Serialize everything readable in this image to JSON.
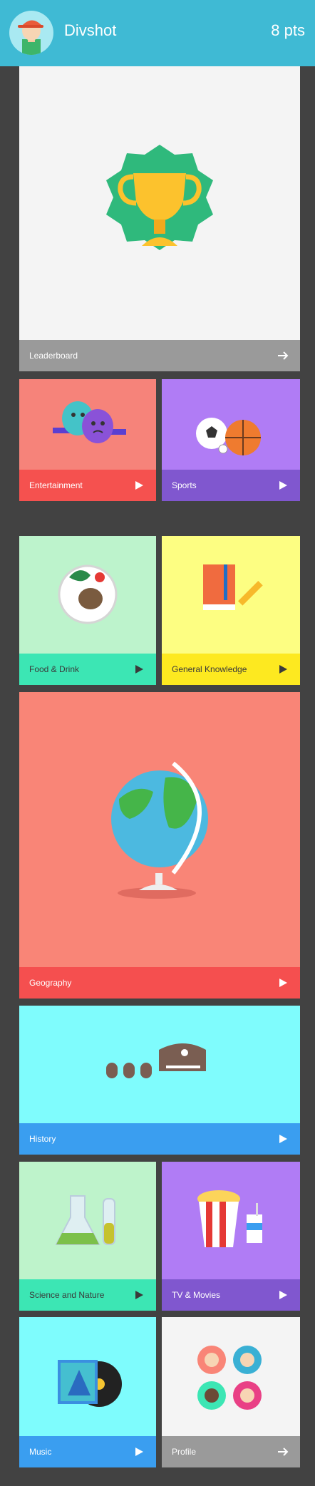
{
  "header": {
    "title": "Divshot",
    "points": "8 pts"
  },
  "cards": {
    "leaderboard": {
      "label": "Leaderboard"
    },
    "entertainment": {
      "label": "Entertainment"
    },
    "sports": {
      "label": "Sports"
    },
    "food": {
      "label": "Food & Drink"
    },
    "general": {
      "label": "General Knowledge"
    },
    "geography": {
      "label": "Geography"
    },
    "history": {
      "label": "History"
    },
    "science": {
      "label": "Science and Nature"
    },
    "tv": {
      "label": "TV & Movies"
    },
    "music": {
      "label": "Music"
    },
    "profile": {
      "label": "Profile"
    }
  },
  "colors": {
    "header": "#3fbad4",
    "background": "#424242",
    "leaderboard": "#f4f4f4",
    "entertainment": "#f6837a",
    "sports": "#b07cf5",
    "food": "#bdf3cc",
    "general": "#fdfe82",
    "geography": "#f98577",
    "history": "#7ffcfd",
    "science": "#bef3cb",
    "tv": "#b07cf5",
    "music": "#7efcfd",
    "profile": "#f4f4f4"
  },
  "icons": {
    "leaderboard": "arrow-right-icon",
    "tiles": "play-triangle-icon",
    "profile": "arrow-right-icon"
  }
}
